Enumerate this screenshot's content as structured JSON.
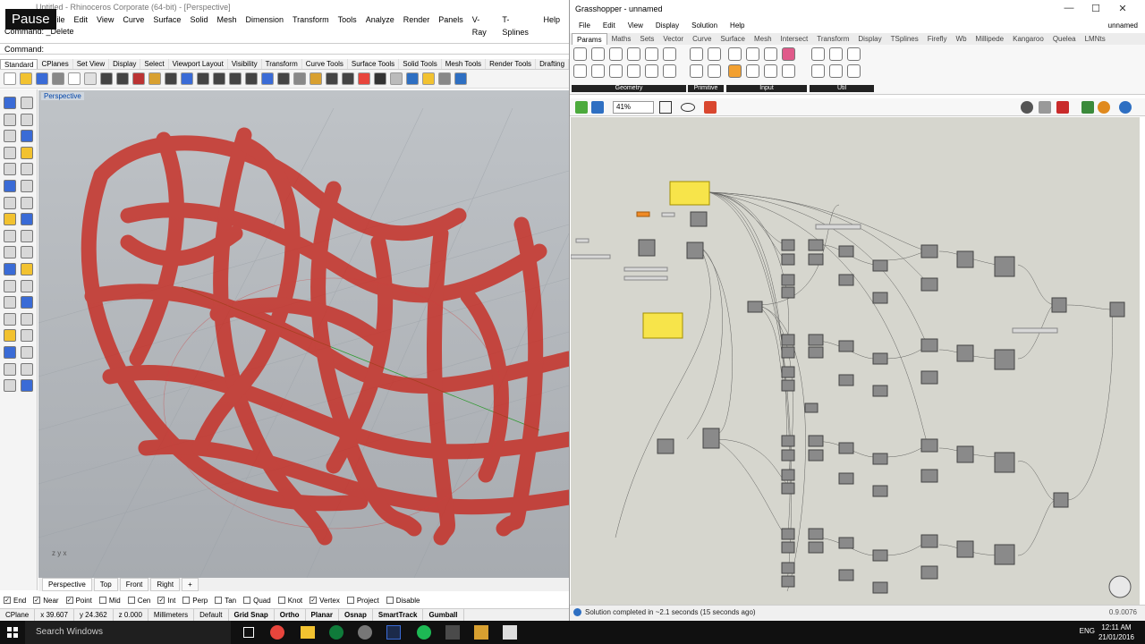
{
  "rhino": {
    "overlay_label": "Pause",
    "title": "Untitled - Rhinoceros Corporate (64-bit) - [Perspective]",
    "menu": [
      "File",
      "Edit",
      "View",
      "Curve",
      "Surface",
      "Solid",
      "Mesh",
      "Dimension",
      "Transform",
      "Tools",
      "Analyze",
      "Render",
      "Panels",
      "V-Ray",
      "T-Splines",
      "Help"
    ],
    "command_history": "Command: _Delete",
    "command_prompt": "Command:",
    "toolbar_tabs": [
      "Standard",
      "CPlanes",
      "Set View",
      "Display",
      "Select",
      "Viewport Layout",
      "Visibility",
      "Transform",
      "Curve Tools",
      "Surface Tools",
      "Solid Tools",
      "Mesh Tools",
      "Render Tools",
      "Drafting"
    ],
    "viewport_label": "Perspective",
    "viewport_tabs": [
      "Perspective",
      "Top",
      "Front",
      "Right",
      "+"
    ],
    "osnaps": [
      {
        "label": "End",
        "checked": true
      },
      {
        "label": "Near",
        "checked": true
      },
      {
        "label": "Point",
        "checked": true
      },
      {
        "label": "Mid",
        "checked": false
      },
      {
        "label": "Cen",
        "checked": false
      },
      {
        "label": "Int",
        "checked": true
      },
      {
        "label": "Perp",
        "checked": false
      },
      {
        "label": "Tan",
        "checked": false
      },
      {
        "label": "Quad",
        "checked": false
      },
      {
        "label": "Knot",
        "checked": false
      },
      {
        "label": "Vertex",
        "checked": true
      },
      {
        "label": "Project",
        "checked": false
      },
      {
        "label": "Disable",
        "checked": false
      }
    ],
    "status": {
      "cplane": "CPlane",
      "x": "x 39.607",
      "y": "y 24.362",
      "z": "z 0.000",
      "units": "Millimeters",
      "layer": "Default",
      "toggles": [
        "Grid Snap",
        "Ortho",
        "Planar",
        "Osnap",
        "SmartTrack",
        "Gumball"
      ]
    },
    "colors": {
      "tube": "#c8261c",
      "viewport_top": "#bfc3c7"
    }
  },
  "grasshopper": {
    "title": "Grasshopper - unnamed",
    "window_buttons": [
      "—",
      "☐",
      "✕"
    ],
    "menu": [
      "File",
      "Edit",
      "View",
      "Display",
      "Solution",
      "Help"
    ],
    "document": "unnamed",
    "tabs": [
      "Params",
      "Maths",
      "Sets",
      "Vector",
      "Curve",
      "Surface",
      "Mesh",
      "Intersect",
      "Transform",
      "Display",
      "TSplines",
      "Firefly",
      "Wb",
      "Millipede",
      "Kangaroo",
      "Quelea",
      "LMNts"
    ],
    "groups": [
      "Geometry",
      "Primitive",
      "Input",
      "Util"
    ],
    "zoom": "41%",
    "solution_message": "Solution completed in ~2.1 seconds (15 seconds ago)",
    "version": "0.9.0076",
    "colors": {
      "canvas": "#d6d6ce",
      "panel": "#f7e44a",
      "component": "#8a8a8a"
    }
  },
  "taskbar": {
    "search_placeholder": "Search Windows",
    "language": "ENG",
    "time": "12:11 AM",
    "date": "21/01/2016"
  }
}
